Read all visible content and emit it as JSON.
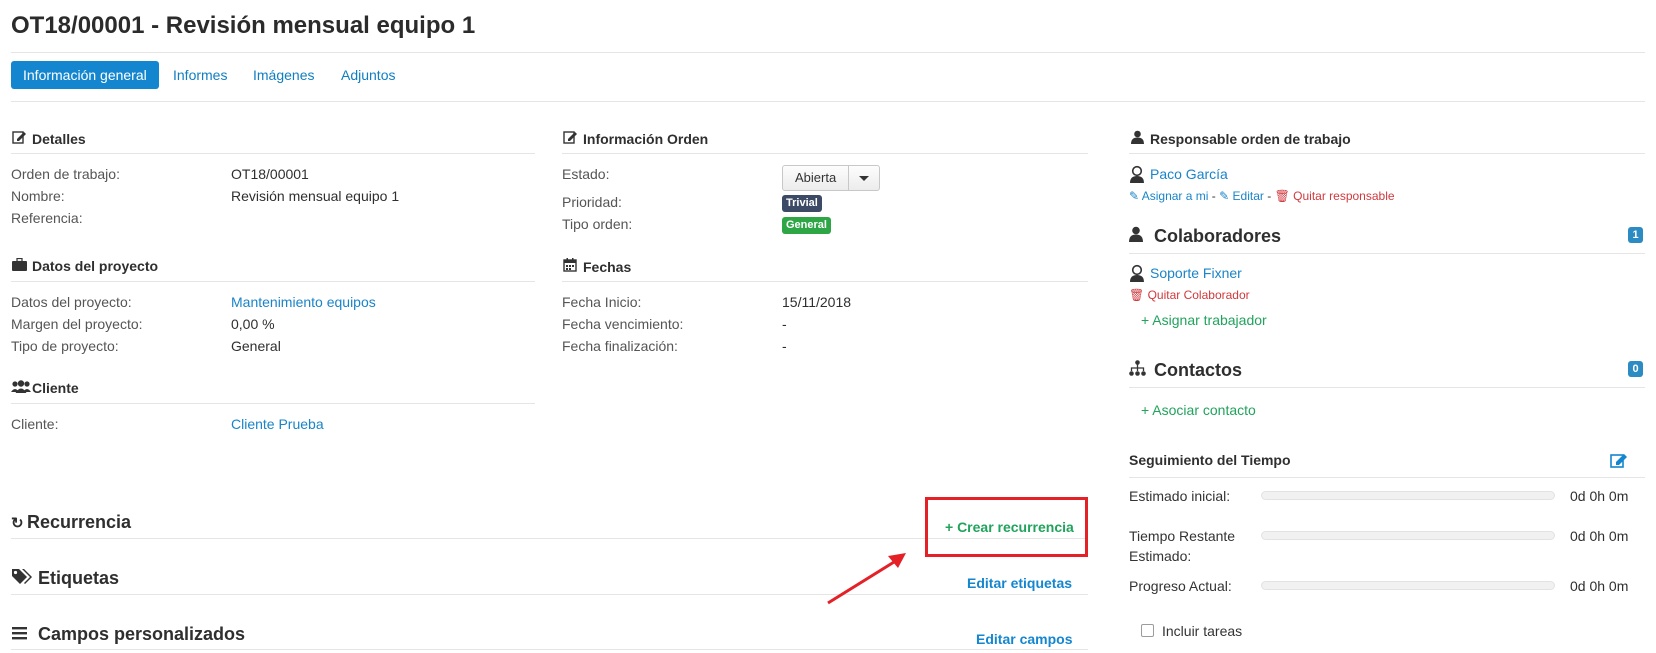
{
  "header": {
    "title": "OT18/00001 - Revisión mensual equipo 1"
  },
  "tabs": [
    {
      "label": "Información general",
      "active": true
    },
    {
      "label": "Informes"
    },
    {
      "label": "Imágenes"
    },
    {
      "label": "Adjuntos"
    }
  ],
  "detalles": {
    "title": "Detalles",
    "rows": [
      {
        "label": "Orden de trabajo:",
        "value": "OT18/00001"
      },
      {
        "label": "Nombre:",
        "value": "Revisión mensual equipo 1"
      },
      {
        "label": "Referencia:",
        "value": ""
      }
    ]
  },
  "proyecto": {
    "title": "Datos del proyecto",
    "rows": [
      {
        "label": "Datos del proyecto:",
        "value": "Mantenimiento equipos"
      },
      {
        "label": "Margen del proyecto:",
        "value": "0,00 %"
      },
      {
        "label": "Tipo de proyecto:",
        "value": "General"
      }
    ]
  },
  "cliente": {
    "title": "Cliente",
    "rows": [
      {
        "label": "Cliente:",
        "value": "Cliente Prueba"
      }
    ]
  },
  "orden": {
    "title": "Información Orden",
    "estado_label": "Estado:",
    "estado_value": "Abierta",
    "prioridad_label": "Prioridad:",
    "prioridad_value": "Trivial",
    "tipo_label": "Tipo orden:",
    "tipo_value": "General",
    "colors": {
      "trivial": "#3d4a66",
      "general": "#2ea646"
    }
  },
  "fechas": {
    "title": "Fechas",
    "rows": [
      {
        "label": "Fecha Inicio:",
        "value": "15/11/2018"
      },
      {
        "label": "Fecha vencimiento:",
        "value": "-"
      },
      {
        "label": "Fecha finalización:",
        "value": "-"
      }
    ]
  },
  "recurrencia": {
    "title": "Recurrencia",
    "action": "+ Crear recurrencia"
  },
  "etiquetas": {
    "title": "Etiquetas",
    "action": "Editar etiquetas"
  },
  "campos": {
    "title": "Campos personalizados",
    "action": "Editar campos"
  },
  "responsable": {
    "title": "Responsable orden de trabajo",
    "name": "Paco García",
    "assign_me": "Asignar a mi",
    "edit": "Editar",
    "remove": "Quitar responsable",
    "sep": "-"
  },
  "colaboradores": {
    "title": "Colaboradores",
    "count": "1",
    "name": "Soporte Fixner",
    "remove": "Quitar Colaborador",
    "assign": "+ Asignar trabajador"
  },
  "contactos": {
    "title": "Contactos",
    "count": "0",
    "associate": "+ Asociar contacto"
  },
  "tiempo": {
    "title": "Seguimiento del Tiempo",
    "rows": [
      {
        "label": "Estimado inicial:",
        "value": "0d 0h 0m",
        "progress": 0
      },
      {
        "label": "Tiempo Restante",
        "label2": "Estimado:",
        "value": "0d 0h 0m",
        "progress": 0
      },
      {
        "label": "Progreso Actual:",
        "value": "0d 0h 0m",
        "progress": 0
      }
    ],
    "include_tasks": "Incluir tareas",
    "include_tasks_checked": false
  }
}
